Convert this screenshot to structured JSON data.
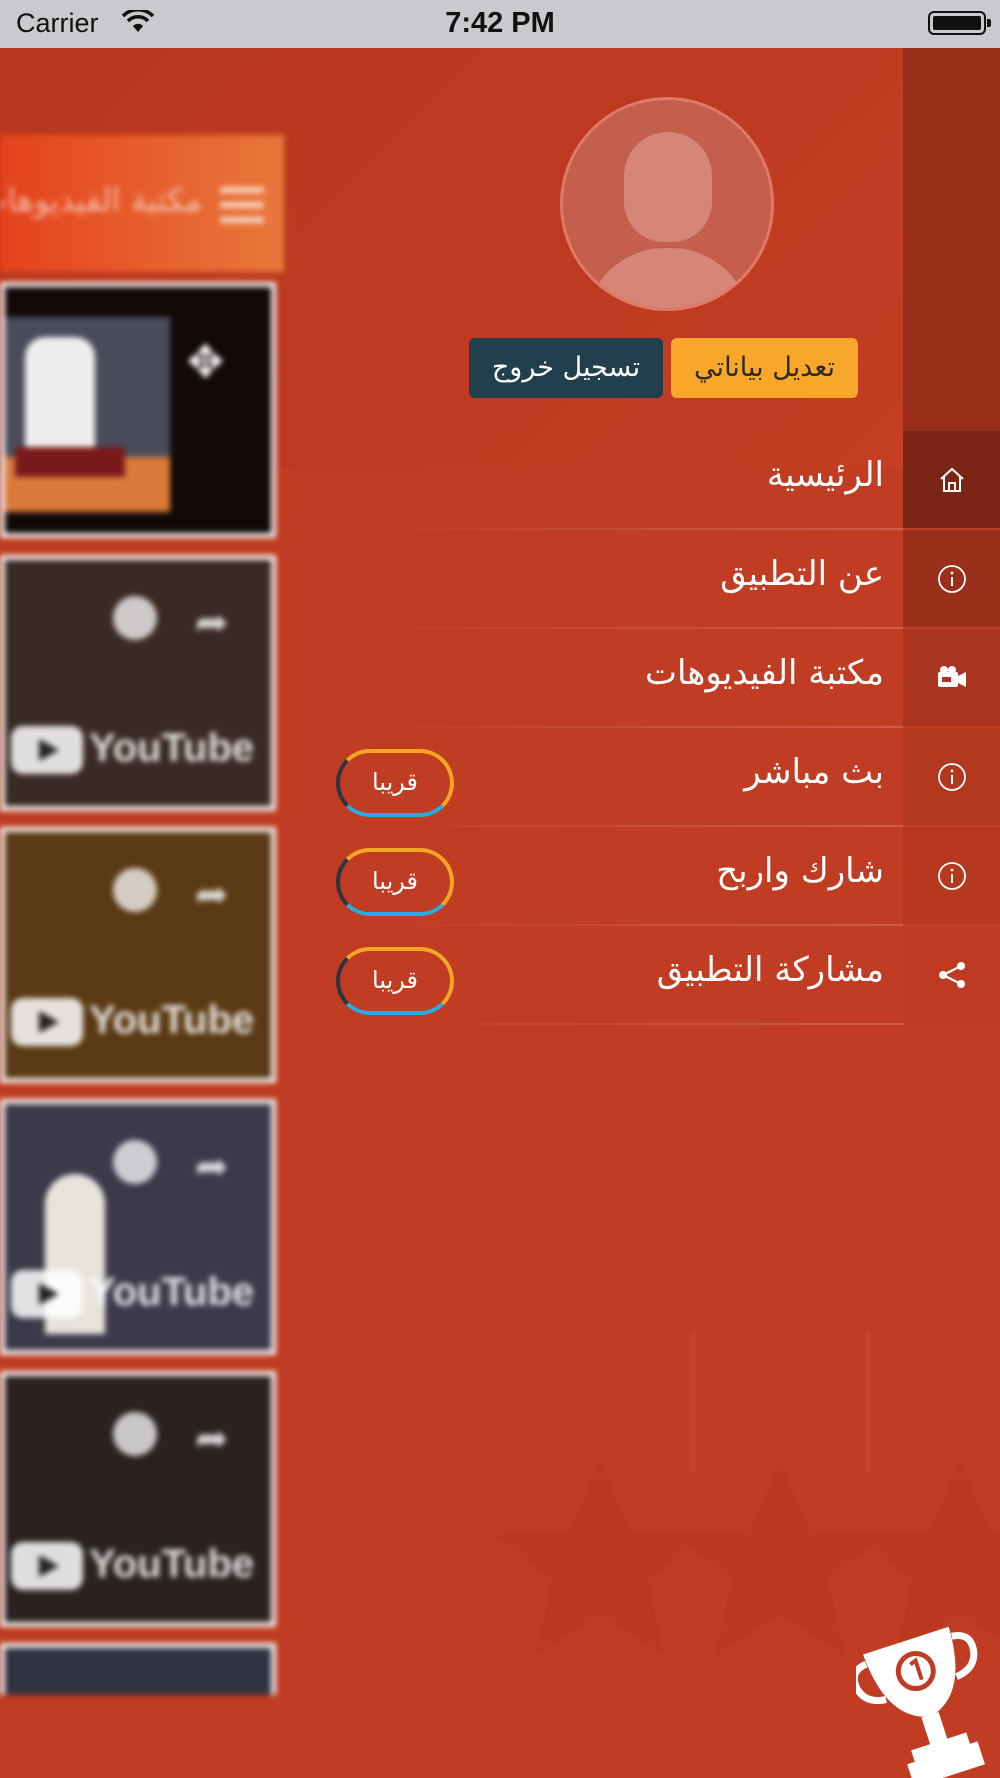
{
  "status_bar": {
    "carrier": "Carrier",
    "time": "7:42 PM"
  },
  "preview": {
    "title": "مكتبة الفيديوهات",
    "cards": [
      {
        "badge": ""
      },
      {
        "badge": "YouTube"
      },
      {
        "badge": "YouTube"
      },
      {
        "badge": "YouTube"
      },
      {
        "badge": "YouTube"
      }
    ]
  },
  "profile": {
    "edit_label": "تعديل بياناتي",
    "logout_label": "تسجيل خروج"
  },
  "menu": {
    "items": [
      {
        "label": "الرئيسية",
        "icon": "home-icon"
      },
      {
        "label": "عن التطبيق",
        "icon": "info-icon"
      },
      {
        "label": "مكتبة الفيديوهات",
        "icon": "video-camera-icon"
      },
      {
        "label": "بث مباشر",
        "icon": "info-icon",
        "badge": "قريبا"
      },
      {
        "label": "شارك واربح",
        "icon": "info-icon",
        "badge": "قريبا"
      },
      {
        "label": "مشاركة التطبيق",
        "icon": "share-icon",
        "badge": "قريبا"
      }
    ]
  },
  "colors": {
    "accent_yellow": "#f9a72b",
    "dark_button": "#223f4d",
    "background": "#c03c22"
  }
}
